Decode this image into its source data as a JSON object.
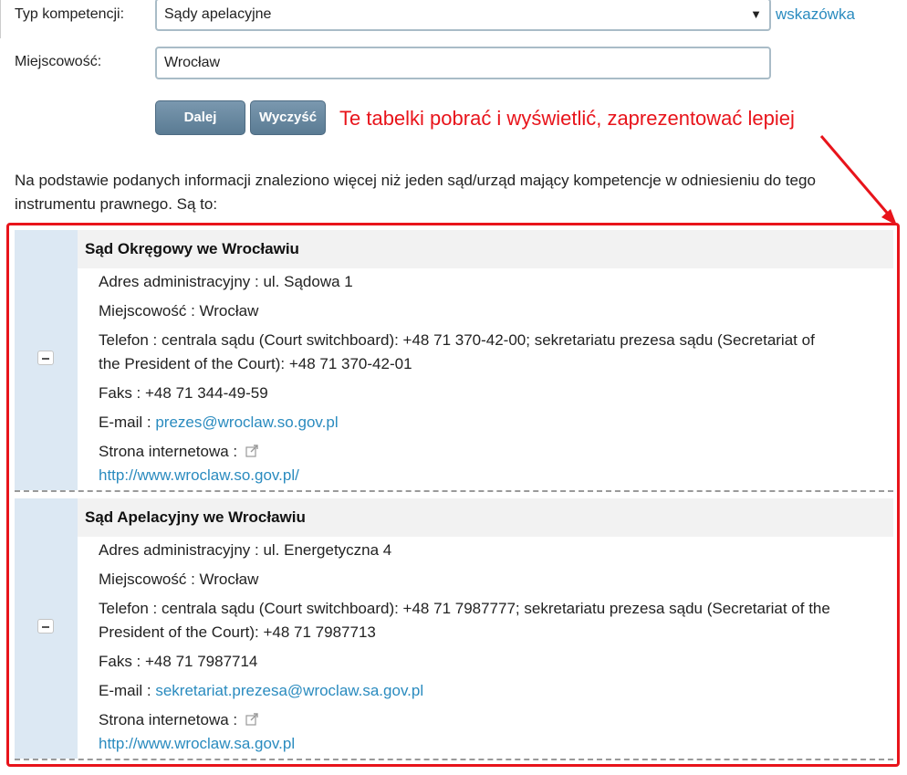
{
  "form": {
    "competence_label": "Typ kompetencji:",
    "competence_value": "Sądy apelacyjne",
    "hint_link": "wskazówka",
    "city_label": "Miejscowość:",
    "city_value": "Wrocław",
    "next_button": "Dalej",
    "clear_button": "Wyczyść"
  },
  "annotation": {
    "text": "Te tabelki pobrać i wyświetlić, zaprezentować lepiej",
    "color": "#e8141b"
  },
  "intro_text": "Na podstawie podanych informacji znaleziono więcej niż jeden sąd/urząd mający kompetencje w odniesieniu do tego instrumentu prawnego. Są to:",
  "courts": [
    {
      "name": "Sąd Okręgowy we Wrocławiu",
      "address": "Adres administracyjny : ul. Sądowa 1",
      "city": "Miejscowość : Wrocław",
      "phone_line1": "Telefon : centrala sądu (Court switchboard): +48 71 370-42-00; sekretariatu prezesa sądu (Secretariat of",
      "phone_line2": "the President of the Court): +48 71 370-42-01",
      "fax": "Faks : +48 71 344-49-59",
      "email_label": "E-mail : ",
      "email": "prezes@wroclaw.so.gov.pl",
      "website_label": "Strona internetowa : ",
      "website": "http://www.wroclaw.so.gov.pl/"
    },
    {
      "name": "Sąd Apelacyjny we Wrocławiu",
      "address": "Adres administracyjny : ul. Energetyczna 4",
      "city": "Miejscowość : Wrocław",
      "phone_line1": "Telefon : centrala sądu (Court switchboard): +48 71 7987777; sekretariatu prezesa sądu (Secretariat of the",
      "phone_line2": "President of the Court): +48 71 7987713",
      "fax": "Faks : +48 71 7987714",
      "email_label": "E-mail : ",
      "email": "sekretariat.prezesa@wroclaw.sa.gov.pl",
      "website_label": "Strona internetowa : ",
      "website": "http://www.wroclaw.sa.gov.pl"
    }
  ]
}
